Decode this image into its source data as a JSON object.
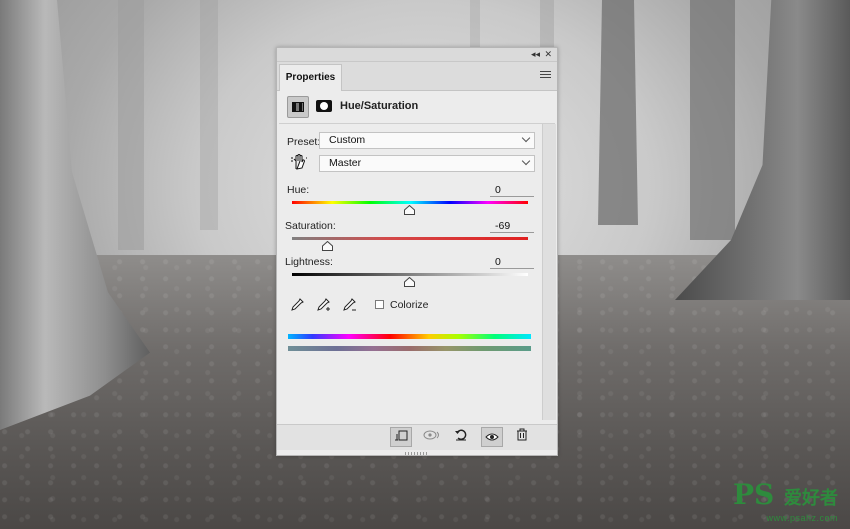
{
  "panel": {
    "tab_title": "Properties",
    "adjustment_title": "Hue/Saturation",
    "icons": {
      "collapse": "double-chevron-left-icon",
      "close": "close-icon",
      "menu": "hamburger-menu-icon",
      "adjustment": "hue-saturation-icon",
      "mask": "layer-mask-icon",
      "on_image": "on-image-adjust-hand-icon"
    }
  },
  "preset": {
    "label": "Preset:",
    "value": "Custom"
  },
  "channel": {
    "value": "Master"
  },
  "hue": {
    "label": "Hue:",
    "value": "0"
  },
  "saturation": {
    "label": "Saturation:",
    "value": "-69"
  },
  "lightness": {
    "label": "Lightness:",
    "value": "0"
  },
  "colorize": {
    "label": "Colorize",
    "checked": false
  },
  "toolbar": {
    "clip": "clip-to-layer-icon",
    "view_previous": "view-previous-state-icon",
    "reset": "reset-icon",
    "visibility": "eye-icon",
    "delete": "trash-icon"
  },
  "watermark": {
    "logo": "PS",
    "cn": "爱好者",
    "url": "www.psahz.com"
  },
  "colors": {
    "accent_watermark": "#2e8b3d",
    "panel_bg": "#ececec"
  }
}
